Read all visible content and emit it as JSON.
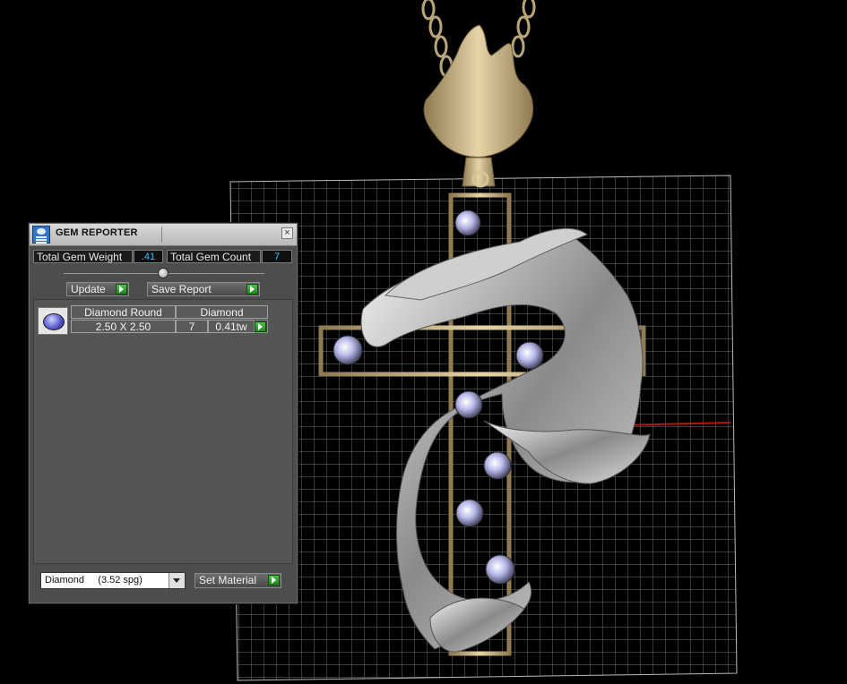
{
  "viewport": {
    "description_icon": "pendant-3d-model"
  },
  "gem_reporter": {
    "title": "GEM REPORTER",
    "close_icon": "close-icon",
    "total_gem_weight_label": "Total Gem Weight",
    "total_gem_weight_value": ".41",
    "total_gem_count_label": "Total Gem Count",
    "total_gem_count_value": "7",
    "update_label": "Update",
    "save_report_label": "Save Report",
    "rows": [
      {
        "shape": "Diamond Round",
        "material": "Diamond",
        "size": "2.50 X 2.50",
        "count": "7",
        "weight": "0.41tw"
      }
    ],
    "material_select": "Diamond     (3.52 spg)",
    "set_material_label": "Set Material"
  },
  "colors": {
    "value_text": "#29c4ff",
    "go_button": "#2fa52f",
    "grid_line": "#bbbbbb",
    "gold": "#c9b184",
    "silver": "#d8d8d8"
  }
}
